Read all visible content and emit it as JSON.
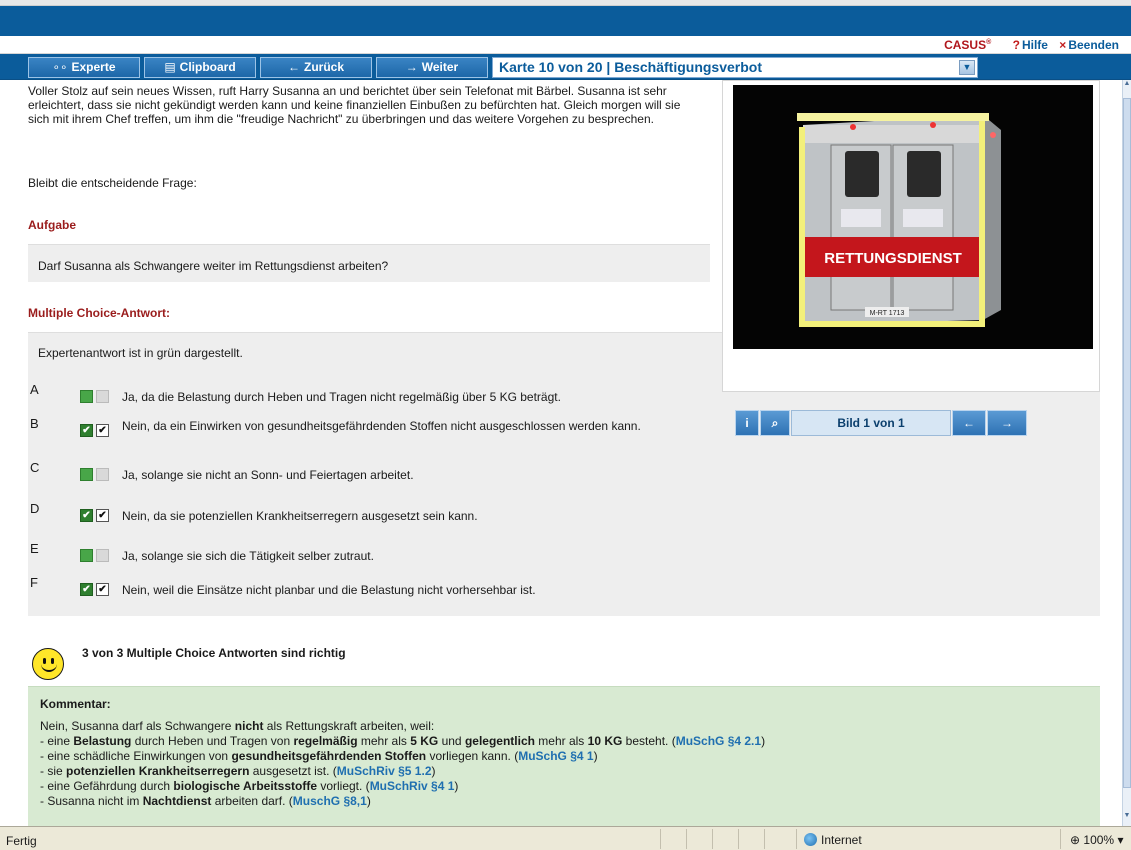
{
  "header": {
    "brand": "CASUS",
    "brand_mark": "®",
    "help_label": "Hilfe",
    "help_mark": "?",
    "quit_label": "Beenden",
    "quit_mark": "×"
  },
  "toolbar": {
    "expert_icon": "∘∘",
    "expert_label": "Experte",
    "clipboard_icon": "▤",
    "clipboard_label": "Clipboard",
    "back_icon": "←",
    "back_label": "Zurück",
    "next_icon": "→",
    "next_label": "Weiter",
    "card_select": "Karte 10 von 20 | Beschäftigungsverbot"
  },
  "main": {
    "intro": "Voller Stolz auf sein neues Wissen, ruft Harry Susanna an und berichtet über sein Telefonat mit Bärbel. Susanna ist sehr erleichtert, dass sie nicht gekündigt werden kann und keine finanziellen Einbußen zu befürchten hat. Gleich morgen will sie sich mit ihrem Chef treffen, um ihm die \"freudige Nachricht\" zu überbringen und das weitere Vorgehen zu besprechen.",
    "question_lead": "Bleibt die entscheidende Frage:",
    "task_heading": "Aufgabe",
    "task_text": "Darf Susanna als Schwangere weiter im Rettungsdienst arbeiten?",
    "mc_heading": "Multiple Choice-Antwort:",
    "expert_note": "Expertenantwort ist in grün dargestellt.",
    "options": [
      {
        "letter": "A",
        "text": "Ja, da die Belastung durch Heben und Tragen nicht regelmäßig über 5 KG beträgt.",
        "expert": false,
        "selected": false
      },
      {
        "letter": "B",
        "text": "Nein, da ein Einwirken von gesundheitsgefährdenden Stoffen nicht ausgeschlossen werden kann.",
        "expert": true,
        "selected": true
      },
      {
        "letter": "C",
        "text": "Ja, solange sie nicht an Sonn- und Feiertagen arbeitet.",
        "expert": false,
        "selected": false
      },
      {
        "letter": "D",
        "text": "Nein, da sie potenziellen Krankheitserregern ausgesetzt sein kann.",
        "expert": true,
        "selected": true
      },
      {
        "letter": "E",
        "text": "Ja, solange sie sich die Tätigkeit selber zutraut.",
        "expert": false,
        "selected": false
      },
      {
        "letter": "F",
        "text": "Nein, weil die Einsätze nicht planbar und die Belastung nicht vorhersehbar ist.",
        "expert": true,
        "selected": true
      }
    ],
    "result_text": "3 von 3 Multiple Choice Antworten sind richtig",
    "comment": {
      "heading": "Kommentar:",
      "l1a": "Nein, Susanna darf als Schwangere ",
      "l1b": "nicht",
      "l1c": " als Rettungskraft arbeiten, weil:",
      "l2a": "- eine ",
      "l2b": "Belastung",
      "l2c": " durch Heben und Tragen von ",
      "l2d": "regelmäßig",
      "l2e": " mehr als ",
      "l2f": "5 KG",
      "l2g": " und ",
      "l2h": "gelegentlich",
      "l2i": " mehr als ",
      "l2j": "10 KG",
      "l2k": " besteht. (",
      "l2ref": "MuSchG §4 2.1",
      "l2end": ")",
      "l3a": "- eine schädliche Einwirkungen von ",
      "l3b": "gesundheitsgefährdenden Stoffen",
      "l3c": " vorliegen kann. (",
      "l3ref": "MuSchG §4 1",
      "l3end": ")",
      "l4a": "- sie ",
      "l4b": "potenziellen Krankheitserregern",
      "l4c": " ausgesetzt ist. (",
      "l4ref": "MuSchRiv §5 1.2",
      "l4end": ")",
      "l5a": "- eine Gefährdung durch ",
      "l5b": "biologische Arbeitsstoffe",
      "l5c": " vorliegt. (",
      "l5ref": "MuSchRiv §4 1",
      "l5end": ")",
      "l6a": "- Susanna nicht im ",
      "l6b": "Nachtdienst",
      "l6c": " arbeiten darf. (",
      "l6ref": "MuschG §8,1",
      "l6end": ")"
    }
  },
  "image_panel": {
    "vehicle_label": "RETTUNGSDIENST",
    "plate": "M-RT 1713",
    "info_icon": "i",
    "zoom_icon": "⌕",
    "counter": "Bild 1 von 1",
    "prev_icon": "←",
    "next_icon": "→"
  },
  "status": {
    "text": "Fertig",
    "zone": "Internet",
    "zoom": "100%",
    "zoom_arrow": "▾"
  }
}
